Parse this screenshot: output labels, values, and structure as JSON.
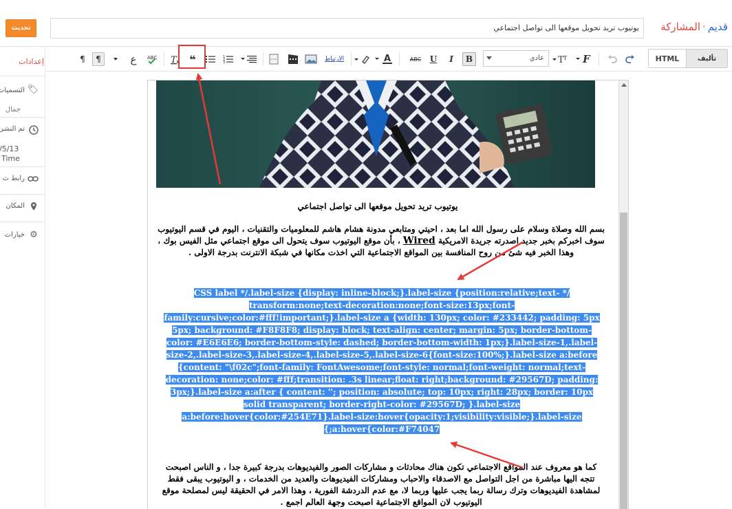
{
  "header": {
    "update_label": "تحديث",
    "post_title": "يوتيوب تريد تحويل موقعها الى تواصل اجتماعي",
    "crumb_old": "قديم",
    "crumb_sep": "·",
    "crumb_post": "المشاركة"
  },
  "sidebar": {
    "settings_label": "إعدادات",
    "labels_label": "التسميات",
    "labels_value": "جمال",
    "scheduled_label": "تم النشر",
    "scheduled_date": "/5/13",
    "scheduled_time": "Time",
    "link_label": "رابط ث",
    "location_label": "المكان",
    "options_label": "خيارات"
  },
  "toolbar": {
    "mode_html": "HTML",
    "mode_compose": "تأليف",
    "font_select": "عادي",
    "link_label": "الارتباط",
    "bold": "B",
    "italic": "I",
    "underline": "U",
    "strike": "ABC",
    "text_color": "A",
    "quote": "❝",
    "lang_label": "ع",
    "rtl_label": "¶",
    "ltr_label": "¶"
  },
  "editor": {
    "title": "يوتيوب تريد تحويل موقعها الى تواصل اجتماعي",
    "para1_part1": "بسم الله وصلاة وسلام على رسول الله اما بعد ، احيتي ومتابعي مدونة هشام هاشم للمعلوميات والتقنيات ، اليوم في قسم اليوتيوب سوف اخبركم بخبر جديد اصدرته جريدة الامريكية",
    "para1_wired": "Wired",
    "para1_part2": "، بأن موقع اليوتيوب سوف يتحول الى موقع اجتماعي مثل الفيس بوك ، وهذا الخبر فيه شئ من روح المنافسة بين المواقع الاجتماعية التي اخذت مكانها في شبكة الانترنت بدرجة الاولى .",
    "code_lines": [
      "CSS label */.label-size {display: inline-block;}.label-size {position:relative;text- */",
      "transform:none;text-decoration:none;font-size:13px;font-",
      "family:cursive;color:#fff!important;}.label-size a {width: 130px; color: #233442; padding: 5px",
      "5px; background: #F8F8F8; display: block; text-align: center; margin: 5px; border-bottom-",
      "color: #E6E6E6; border-bottom-style: dashed; border-bottom-width: 1px;}.label-size-1,.label-",
      "size-2,.label-size-3,.label-size-4,.label-size-5,.label-size-6{font-size:100%;}.label-size a:before",
      "{content: \"\\f02c\";font-family: FontAwesome;font-style: normal;font-weight: normal;text-",
      "decoration: none;color: #fff;transition: .3s linear;float: right;background: #29567D; padding:",
      "3px;}.label-size a:after { content: ''; position: absolute; top: 10px; right: 28px; border: 10px",
      "solid transparent; border-right-color: #29567D; }.label-size",
      "a:before:hover{color:#254E71}.label-size:hover{opacity:1;visibility:visible;}.label-size",
      "{;a:hover{color:#F74047"
    ],
    "para2": "كما هو معروف عند المواقع الاجتماعي تكون هناك محادثات و مشاركات الصور والفيديوهات بدرجة كبيرة جدا ، و الناس اصبحت تتجه اليها مباشرة من اجل التواصل مع الاصدقاء والاحباب ومشاركات الفيديوهات والعديد من الخدمات ، و اليوتيوب يبقى فقط لمشاهدة الفيديوهات وترك رسالة ربما يجب عليها وربما لا، مع عدم الدردشة الفورية ، وهذا الامر في الحقيقة ليس لمصلحة موقع اليوتيوب لان المواقع الاجتماعية اصبحت وجهة العالم اجمع ."
  },
  "colors": {
    "update_button": "#f48a2c",
    "selection": "#3d8bf0",
    "annotation": "#e53935"
  }
}
